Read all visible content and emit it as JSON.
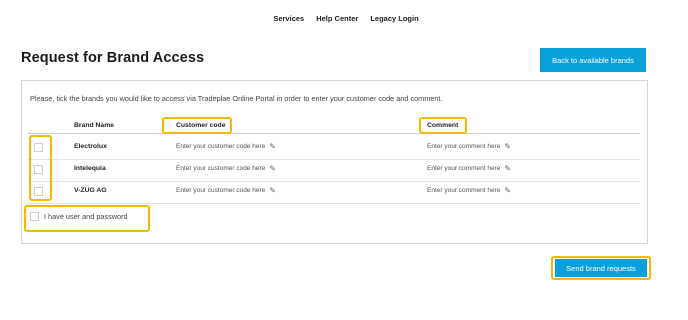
{
  "nav": {
    "items": [
      "Services",
      "Help Center",
      "Legacy Login"
    ]
  },
  "page": {
    "title": "Request for Brand Access"
  },
  "buttons": {
    "back": "Back to available brands",
    "send": "Send brand requests"
  },
  "panel": {
    "instructions": "Please, tick the brands you would like to access via Tradeplae Online Portal in order to enter your customer code and comment.",
    "headers": {
      "brand": "Brand Name",
      "customer_code": "Customer code",
      "comment": "Comment"
    },
    "rows": [
      {
        "brand": "Electrolux",
        "code_placeholder": "Enter your customer code here",
        "comment_placeholder": "Enter your comment here"
      },
      {
        "brand": "Intelequia",
        "code_placeholder": "Enter your customer code here",
        "comment_placeholder": "Enter your comment here"
      },
      {
        "brand": "V-ZUG AG",
        "code_placeholder": "Enter your customer code here",
        "comment_placeholder": "Enter your comment here"
      }
    ],
    "user_password_label": "I have user and password"
  },
  "colors": {
    "accent": "#0aa0dc",
    "highlight": "#f2bb00"
  },
  "icons": {
    "edit": "pencil-icon"
  }
}
